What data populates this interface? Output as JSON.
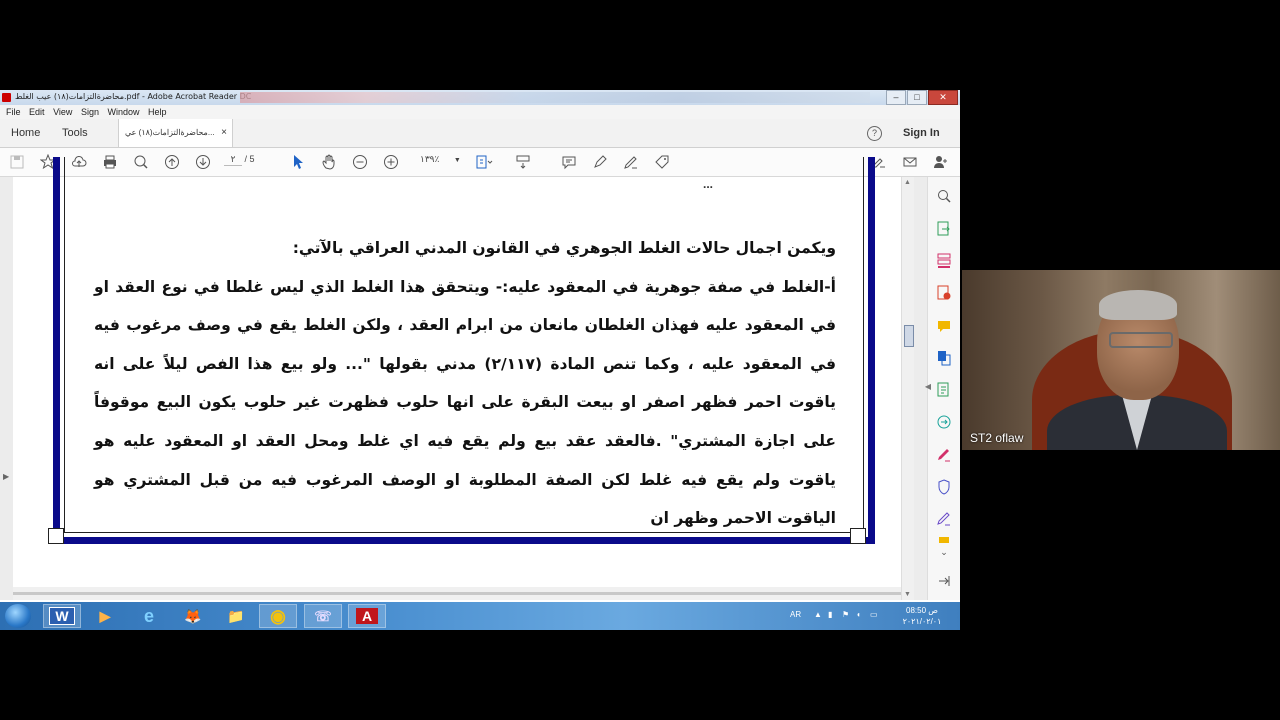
{
  "window": {
    "title": "محاضرةالتزامات(١٨) عيب الغلط.pdf - Adobe Acrobat Reader DC",
    "controls": {
      "minimize": "–",
      "maximize": "□",
      "close": "✕"
    }
  },
  "menu": [
    "File",
    "Edit",
    "View",
    "Sign",
    "Window",
    "Help"
  ],
  "tabs": {
    "home": "Home",
    "tools": "Tools",
    "document": "محاضرةالتزامات(١٨) عي...",
    "close": "×"
  },
  "header_right": {
    "help": "?",
    "sign_in": "Sign In"
  },
  "toolbar": {
    "page_current": "٢",
    "page_total": "/ 5",
    "zoom": "١٣٩٪"
  },
  "document": {
    "cut_top_line": "...",
    "paragraphs": [
      "ويكمن اجمال حالات الغلط الجوهري في القانون المدني العراقي بالآتي:",
      "أ-الغلط في صفة جوهرية في المعقود عليه:- ويتحقق هذا الغلط الذي ليس غلطا في نوع العقد او في المعقود عليه فهذان الغلطان مانعان من ابرام العقد ، ولكن الغلط يقع في وصف مرغوب فيه في المعقود عليه ، وكما تنص المادة (٢/١١٧) مدني بقولها \"... ولو بيع هذا الفص ليلاً على انه ياقوت احمر فظهر اصفر او بيعت البقرة على انها حلوب فظهرت غير حلوب يكون البيع موقوفاً على اجازة المشتري\" .فالعقد عقد بيع ولم يقع فيه اي غلط ومحل العقد او المعقود عليه هو ياقوت ولم يقع فيه غلط لكن الصفة المطلوبة او الوصف المرغوب فيه من قبل المشتري هو الياقوت الاحمر وظهر ان"
    ]
  },
  "taskbar": {
    "apps": [
      "W",
      "▶",
      "e",
      "🦊",
      "📁",
      "◉",
      "☏",
      "A"
    ],
    "language": "AR",
    "time": "08:50 ص",
    "date": "٢٠٢١/٠٢/٠١"
  },
  "webcam": {
    "participant": "ST2 oflaw"
  }
}
